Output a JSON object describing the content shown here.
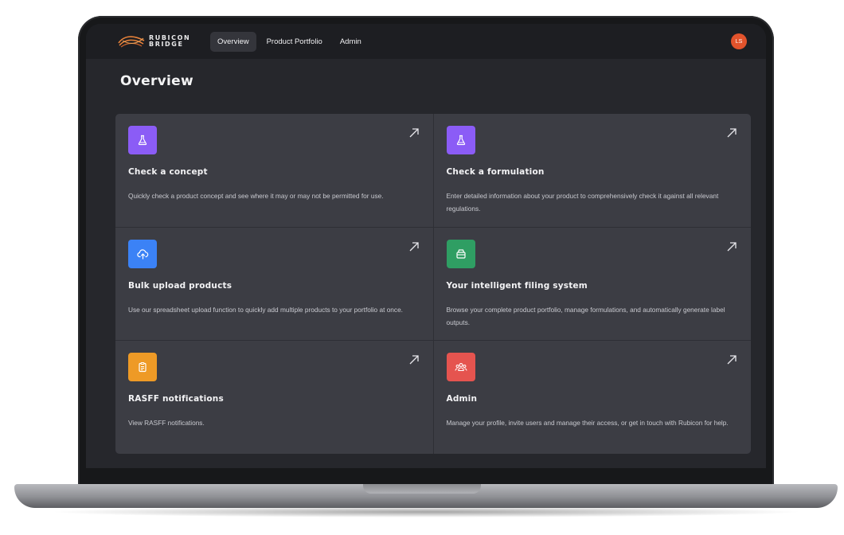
{
  "brand": {
    "line1": "RUBICON",
    "line2": "BRIDGE",
    "color": "#e8823a"
  },
  "nav": {
    "items": [
      {
        "label": "Overview",
        "active": true
      },
      {
        "label": "Product Portfolio",
        "active": false
      },
      {
        "label": "Admin",
        "active": false
      }
    ],
    "avatar_initials": "LS",
    "avatar_color": "#e2532c"
  },
  "page": {
    "title": "Overview"
  },
  "cards": [
    {
      "title": "Check a concept",
      "description": "Quickly check a product concept and see where it may or may not be permitted for use.",
      "icon": "flask-icon",
      "color": "#8b5cf6"
    },
    {
      "title": "Check a formulation",
      "description": "Enter detailed information about your product to comprehensively check it against all relevant regulations.",
      "icon": "flask-icon",
      "color": "#8b5cf6"
    },
    {
      "title": "Bulk upload products",
      "description": "Use our spreadsheet upload function to quickly add multiple products to your portfolio at once.",
      "icon": "cloud-upload-icon",
      "color": "#3b82f6"
    },
    {
      "title": "Your intelligent filing system",
      "description": "Browse your complete product portfolio, manage formulations, and automatically generate label outputs.",
      "icon": "archive-icon",
      "color": "#2f9e63"
    },
    {
      "title": "RASFF notifications",
      "description": "View RASFF notifications.",
      "icon": "clipboard-icon",
      "color": "#ee9a26"
    },
    {
      "title": "Admin",
      "description": "Manage your profile, invite users and manage their access, or get in touch with Rubicon for help.",
      "icon": "users-icon",
      "color": "#e5544f"
    }
  ]
}
